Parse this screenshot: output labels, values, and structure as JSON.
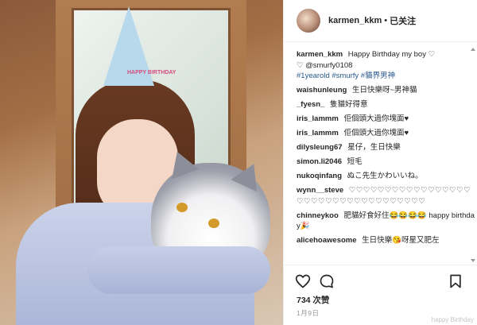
{
  "post": {
    "username": "karmen_kkm",
    "separator": "•",
    "follow_status": "已关注",
    "likes": "734 次赞",
    "date": "1月9日",
    "watermark": "happy Birthday"
  },
  "photo": {
    "hat_text": "HAPPY BIRTHDAY"
  },
  "comments": [
    {
      "user": "karmen_kkm",
      "text": "Happy Birthday my boy ♡",
      "extra": "♡ @smurfy0108",
      "tags": "#1yearold #smurfy #貓界男神"
    },
    {
      "user": "waishunleung",
      "text": "生日快樂呀~男神貓"
    },
    {
      "user": "_fyesn_",
      "text": "隻貓好得意"
    },
    {
      "user": "iris_lammm",
      "text": "佢個頭大過你塊面♥"
    },
    {
      "user": "iris_lammm",
      "text": "佢個頭大過你塊面♥"
    },
    {
      "user": "dilysleung67",
      "text": "星仔，生日快樂"
    },
    {
      "user": "simon.li2046",
      "text": "短毛"
    },
    {
      "user": "nukoqinfang",
      "text": "ぬこ先生かわいいね。"
    },
    {
      "user": "wynn__steve",
      "text": "♡♡♡♡♡♡♡♡♡♡♡♡♡♡♡♡♡♡♡♡♡♡♡♡♡♡♡♡♡♡♡♡♡♡♡"
    },
    {
      "user": "chinneykoo",
      "text": "肥貓好食好住😂😂😂😂 happy birthday🎉"
    },
    {
      "user": "alicehoawesome",
      "text": "生日快樂😘呀星又肥左"
    }
  ],
  "icons": {
    "like": "heart-icon",
    "comment": "comment-bubble-icon",
    "save": "bookmark-icon"
  }
}
